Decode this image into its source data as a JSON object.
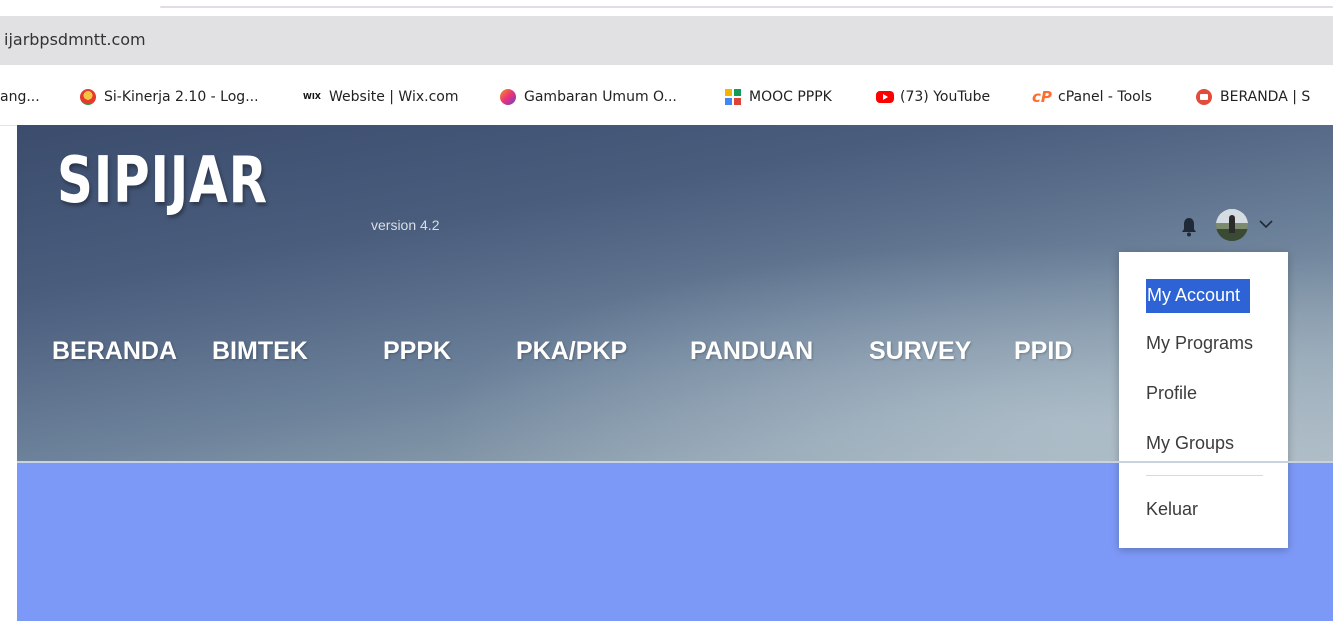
{
  "browser": {
    "address": "ijarbpsdmntt.com",
    "bookmarks": [
      {
        "label": "ang...",
        "icon": "none"
      },
      {
        "label": "Si-Kinerja 2.10 - Log...",
        "icon": "sikinerja-icon"
      },
      {
        "label": "Website | Wix.com",
        "icon": "wix-icon",
        "icon_text": "WIX"
      },
      {
        "label": "Gambaran Umum O...",
        "icon": "moodle-icon"
      },
      {
        "label": "MOOC PPPK",
        "icon": "mooc-icon"
      },
      {
        "label": "(73) YouTube",
        "icon": "youtube-icon"
      },
      {
        "label": "cPanel - Tools",
        "icon": "cpanel-icon",
        "icon_text": "cP"
      },
      {
        "label": "BERANDA | S",
        "icon": "beranda-icon"
      }
    ]
  },
  "site": {
    "logo": "SIPIJAR",
    "version": "version 4.2",
    "nav": [
      "BERANDA",
      "BIMTEK",
      "PPPK",
      "PKA/PKP",
      "PANDUAN",
      "SURVEY",
      "PPID"
    ]
  },
  "user_menu": {
    "items": [
      "My Account",
      "My Programs",
      "Profile",
      "My Groups"
    ],
    "logout": "Keluar",
    "active_index": 0
  },
  "colors": {
    "accent": "#2d63d4",
    "content_background": "#7d99f8",
    "address_bar": "#e1e1e4"
  }
}
